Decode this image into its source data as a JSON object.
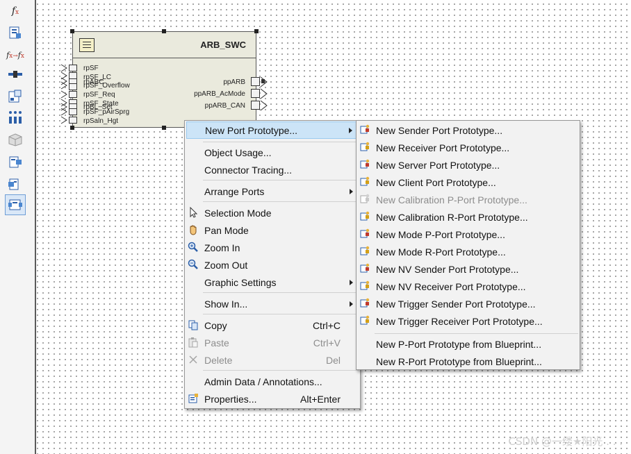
{
  "palette": {
    "tools": [
      "function-icon",
      "properties-icon",
      "formula-icon",
      "connector-icon",
      "component-icon",
      "ports-icon",
      "cube-icon",
      "port-add-icon",
      "port-remove-icon",
      "composition-icon"
    ],
    "fx_label": "f",
    "fx_sub": "x",
    "fxfx_label": "f",
    "fxfx_mid": "x→",
    "fxfx_end": "f",
    "fxfx_sub": "x"
  },
  "component": {
    "name": "ARB_SWC",
    "r_ports": [
      "rpSF",
      "rpSF_LC",
      "rpABC",
      "rpSF_Overflow",
      "rpSF_Req",
      "rpSF_State",
      "rpBL_Set",
      "rpSF_pAirSprg",
      "rpSaln_Hgt"
    ],
    "p_ports": [
      "ppARB",
      "ppARB_AcMode",
      "ppARB_CAN"
    ]
  },
  "context_menu": {
    "new_port": "New Port Prototype...",
    "object_usage": "Object Usage...",
    "connector_tracing": "Connector Tracing...",
    "arrange_ports": "Arrange Ports",
    "selection_mode": "Selection Mode",
    "pan_mode": "Pan Mode",
    "zoom_in": "Zoom In",
    "zoom_out": "Zoom Out",
    "graphic_settings": "Graphic Settings",
    "show_in": "Show In...",
    "copy": "Copy",
    "copy_sc": "Ctrl+C",
    "paste": "Paste",
    "paste_sc": "Ctrl+V",
    "delete": "Delete",
    "delete_sc": "Del",
    "admin_data": "Admin Data / Annotations...",
    "properties": "Properties...",
    "properties_sc": "Alt+Enter"
  },
  "submenu": {
    "items": [
      {
        "label": "New Sender Port Prototype...",
        "enabled": true
      },
      {
        "label": "New Receiver Port Prototype...",
        "enabled": true
      },
      {
        "label": "New Server Port Prototype...",
        "enabled": true
      },
      {
        "label": "New Client Port Prototype...",
        "enabled": true
      },
      {
        "label": "New Calibration P-Port Prototype...",
        "enabled": false
      },
      {
        "label": "New Calibration R-Port Prototype...",
        "enabled": true
      },
      {
        "label": "New Mode P-Port Prototype...",
        "enabled": true
      },
      {
        "label": "New Mode R-Port Prototype...",
        "enabled": true
      },
      {
        "label": "New NV Sender Port Prototype...",
        "enabled": true
      },
      {
        "label": "New NV Receiver Port Prototype...",
        "enabled": true
      },
      {
        "label": "New Trigger Sender Port Prototype...",
        "enabled": true
      },
      {
        "label": "New Trigger Receiver Port Prototype...",
        "enabled": true
      }
    ],
    "blueprint_p": "New P-Port Prototype from Blueprint...",
    "blueprint_r": "New R-Port Prototype from Blueprint..."
  },
  "watermark": "CSDN @一缕★阳光 . . ."
}
